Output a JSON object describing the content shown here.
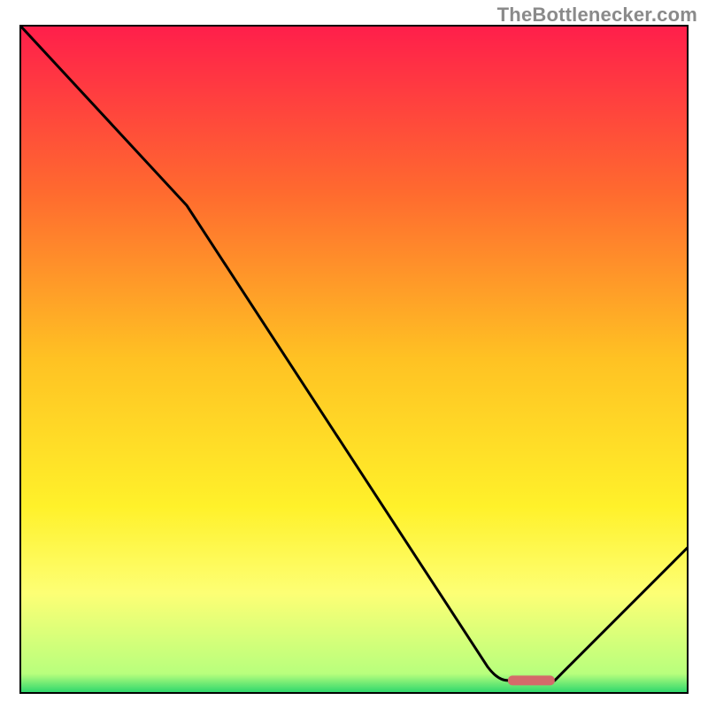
{
  "watermark": "TheBottlenecker.com",
  "chart_data": {
    "type": "line",
    "title": "",
    "xlabel": "",
    "ylabel": "",
    "xlim": [
      0,
      100
    ],
    "ylim": [
      0,
      100
    ],
    "grid": false,
    "series": [
      {
        "name": "curve",
        "x": [
          0,
          25,
          70,
          73,
          80,
          100
        ],
        "y": [
          100,
          73,
          4,
          2,
          2,
          22
        ]
      }
    ],
    "marker": {
      "name": "optimal-range",
      "x_start": 73,
      "x_end": 80,
      "y": 2,
      "color": "#d46a6a"
    },
    "background": {
      "type": "vertical-gradient",
      "stops": [
        {
          "offset": 0.0,
          "color": "#ff1e4b"
        },
        {
          "offset": 0.25,
          "color": "#ff6a2f"
        },
        {
          "offset": 0.5,
          "color": "#ffc223"
        },
        {
          "offset": 0.72,
          "color": "#fff12a"
        },
        {
          "offset": 0.85,
          "color": "#fdff75"
        },
        {
          "offset": 0.97,
          "color": "#b8ff7d"
        },
        {
          "offset": 1.0,
          "color": "#23d36b"
        }
      ]
    },
    "frame_color": "#000000",
    "line_color": "#000000",
    "line_width": 3
  }
}
